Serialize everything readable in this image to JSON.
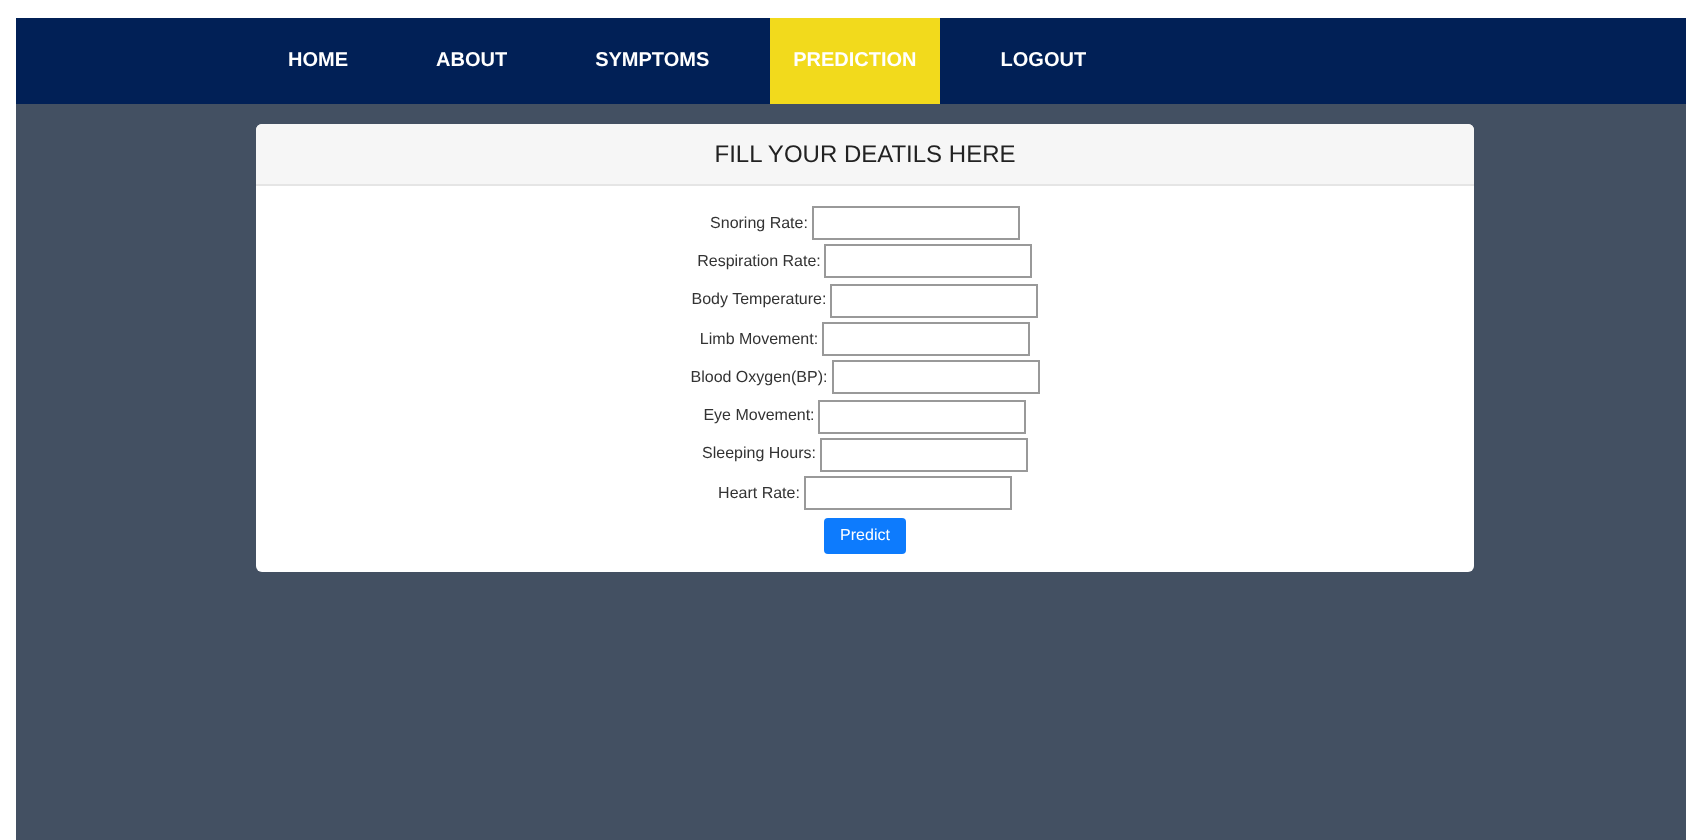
{
  "nav": [
    {
      "label": "HOME",
      "selected": false
    },
    {
      "label": "ABOUT",
      "selected": false
    },
    {
      "label": "SYMPTOMS",
      "selected": false
    },
    {
      "label": "PREDICTION",
      "selected": true
    },
    {
      "label": "LOGOUT",
      "selected": false
    }
  ],
  "form": {
    "title": "FILL YOUR DEATILS HERE",
    "fields": [
      {
        "label": "Snoring Rate:"
      },
      {
        "label": "Respiration Rate:"
      },
      {
        "label": "Body Temperature:"
      },
      {
        "label": "Limb Movement:"
      },
      {
        "label": "Blood Oxygen(BP):"
      },
      {
        "label": "Eye Movement:"
      },
      {
        "label": "Sleeping Hours:"
      },
      {
        "label": "Heart Rate:"
      }
    ],
    "button": "Predict"
  }
}
